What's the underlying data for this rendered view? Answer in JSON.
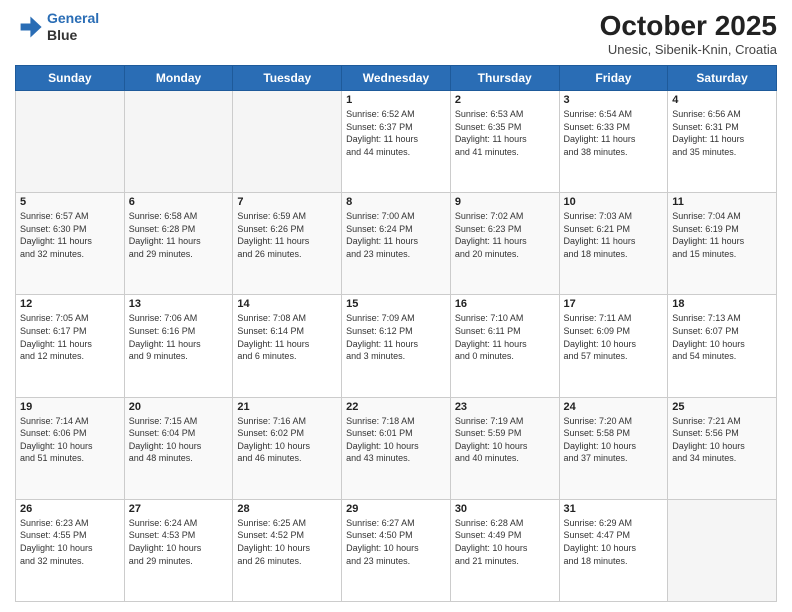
{
  "header": {
    "logo_line1": "General",
    "logo_line2": "Blue",
    "month": "October 2025",
    "location": "Unesic, Sibenik-Knin, Croatia"
  },
  "days_of_week": [
    "Sunday",
    "Monday",
    "Tuesday",
    "Wednesday",
    "Thursday",
    "Friday",
    "Saturday"
  ],
  "weeks": [
    [
      {
        "day": "",
        "info": ""
      },
      {
        "day": "",
        "info": ""
      },
      {
        "day": "",
        "info": ""
      },
      {
        "day": "1",
        "info": "Sunrise: 6:52 AM\nSunset: 6:37 PM\nDaylight: 11 hours\nand 44 minutes."
      },
      {
        "day": "2",
        "info": "Sunrise: 6:53 AM\nSunset: 6:35 PM\nDaylight: 11 hours\nand 41 minutes."
      },
      {
        "day": "3",
        "info": "Sunrise: 6:54 AM\nSunset: 6:33 PM\nDaylight: 11 hours\nand 38 minutes."
      },
      {
        "day": "4",
        "info": "Sunrise: 6:56 AM\nSunset: 6:31 PM\nDaylight: 11 hours\nand 35 minutes."
      }
    ],
    [
      {
        "day": "5",
        "info": "Sunrise: 6:57 AM\nSunset: 6:30 PM\nDaylight: 11 hours\nand 32 minutes."
      },
      {
        "day": "6",
        "info": "Sunrise: 6:58 AM\nSunset: 6:28 PM\nDaylight: 11 hours\nand 29 minutes."
      },
      {
        "day": "7",
        "info": "Sunrise: 6:59 AM\nSunset: 6:26 PM\nDaylight: 11 hours\nand 26 minutes."
      },
      {
        "day": "8",
        "info": "Sunrise: 7:00 AM\nSunset: 6:24 PM\nDaylight: 11 hours\nand 23 minutes."
      },
      {
        "day": "9",
        "info": "Sunrise: 7:02 AM\nSunset: 6:23 PM\nDaylight: 11 hours\nand 20 minutes."
      },
      {
        "day": "10",
        "info": "Sunrise: 7:03 AM\nSunset: 6:21 PM\nDaylight: 11 hours\nand 18 minutes."
      },
      {
        "day": "11",
        "info": "Sunrise: 7:04 AM\nSunset: 6:19 PM\nDaylight: 11 hours\nand 15 minutes."
      }
    ],
    [
      {
        "day": "12",
        "info": "Sunrise: 7:05 AM\nSunset: 6:17 PM\nDaylight: 11 hours\nand 12 minutes."
      },
      {
        "day": "13",
        "info": "Sunrise: 7:06 AM\nSunset: 6:16 PM\nDaylight: 11 hours\nand 9 minutes."
      },
      {
        "day": "14",
        "info": "Sunrise: 7:08 AM\nSunset: 6:14 PM\nDaylight: 11 hours\nand 6 minutes."
      },
      {
        "day": "15",
        "info": "Sunrise: 7:09 AM\nSunset: 6:12 PM\nDaylight: 11 hours\nand 3 minutes."
      },
      {
        "day": "16",
        "info": "Sunrise: 7:10 AM\nSunset: 6:11 PM\nDaylight: 11 hours\nand 0 minutes."
      },
      {
        "day": "17",
        "info": "Sunrise: 7:11 AM\nSunset: 6:09 PM\nDaylight: 10 hours\nand 57 minutes."
      },
      {
        "day": "18",
        "info": "Sunrise: 7:13 AM\nSunset: 6:07 PM\nDaylight: 10 hours\nand 54 minutes."
      }
    ],
    [
      {
        "day": "19",
        "info": "Sunrise: 7:14 AM\nSunset: 6:06 PM\nDaylight: 10 hours\nand 51 minutes."
      },
      {
        "day": "20",
        "info": "Sunrise: 7:15 AM\nSunset: 6:04 PM\nDaylight: 10 hours\nand 48 minutes."
      },
      {
        "day": "21",
        "info": "Sunrise: 7:16 AM\nSunset: 6:02 PM\nDaylight: 10 hours\nand 46 minutes."
      },
      {
        "day": "22",
        "info": "Sunrise: 7:18 AM\nSunset: 6:01 PM\nDaylight: 10 hours\nand 43 minutes."
      },
      {
        "day": "23",
        "info": "Sunrise: 7:19 AM\nSunset: 5:59 PM\nDaylight: 10 hours\nand 40 minutes."
      },
      {
        "day": "24",
        "info": "Sunrise: 7:20 AM\nSunset: 5:58 PM\nDaylight: 10 hours\nand 37 minutes."
      },
      {
        "day": "25",
        "info": "Sunrise: 7:21 AM\nSunset: 5:56 PM\nDaylight: 10 hours\nand 34 minutes."
      }
    ],
    [
      {
        "day": "26",
        "info": "Sunrise: 6:23 AM\nSunset: 4:55 PM\nDaylight: 10 hours\nand 32 minutes."
      },
      {
        "day": "27",
        "info": "Sunrise: 6:24 AM\nSunset: 4:53 PM\nDaylight: 10 hours\nand 29 minutes."
      },
      {
        "day": "28",
        "info": "Sunrise: 6:25 AM\nSunset: 4:52 PM\nDaylight: 10 hours\nand 26 minutes."
      },
      {
        "day": "29",
        "info": "Sunrise: 6:27 AM\nSunset: 4:50 PM\nDaylight: 10 hours\nand 23 minutes."
      },
      {
        "day": "30",
        "info": "Sunrise: 6:28 AM\nSunset: 4:49 PM\nDaylight: 10 hours\nand 21 minutes."
      },
      {
        "day": "31",
        "info": "Sunrise: 6:29 AM\nSunset: 4:47 PM\nDaylight: 10 hours\nand 18 minutes."
      },
      {
        "day": "",
        "info": ""
      }
    ]
  ]
}
